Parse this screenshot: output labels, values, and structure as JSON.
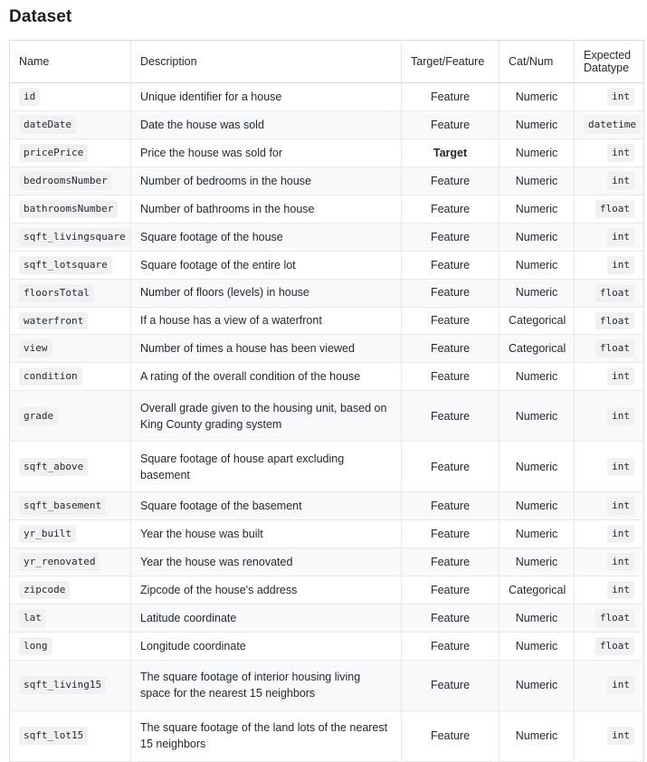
{
  "page": {
    "title": "Dataset"
  },
  "table": {
    "columns": [
      {
        "key": "name",
        "label": "Name"
      },
      {
        "key": "desc",
        "label": "Description"
      },
      {
        "key": "tf",
        "label": "Target/Feature"
      },
      {
        "key": "catnum",
        "label": "Cat/Num"
      },
      {
        "key": "dtype",
        "label": "Expected Datatype"
      }
    ],
    "rows": [
      {
        "name": "id",
        "desc": "Unique identifier for a house",
        "tf": "Feature",
        "catnum": "Numeric",
        "dtype": "int",
        "tall": false
      },
      {
        "name": "dateDate",
        "desc": "Date the house was sold",
        "tf": "Feature",
        "catnum": "Numeric",
        "dtype": "datetime",
        "tall": false
      },
      {
        "name": "pricePrice",
        "desc": "Price the house was sold for",
        "tf": "Target",
        "catnum": "Numeric",
        "dtype": "int",
        "tall": false
      },
      {
        "name": "bedroomsNumber",
        "desc": "Number of bedrooms in the house",
        "tf": "Feature",
        "catnum": "Numeric",
        "dtype": "int",
        "tall": false
      },
      {
        "name": "bathroomsNumber",
        "desc": "Number of bathrooms in the house",
        "tf": "Feature",
        "catnum": "Numeric",
        "dtype": "float",
        "tall": false
      },
      {
        "name": "sqft_livingsquare",
        "desc": "Square footage of the house",
        "tf": "Feature",
        "catnum": "Numeric",
        "dtype": "int",
        "tall": false
      },
      {
        "name": "sqft_lotsquare",
        "desc": "Square footage of the entire lot",
        "tf": "Feature",
        "catnum": "Numeric",
        "dtype": "int",
        "tall": false
      },
      {
        "name": "floorsTotal",
        "desc": "Number of floors (levels) in house",
        "tf": "Feature",
        "catnum": "Numeric",
        "dtype": "float",
        "tall": false
      },
      {
        "name": "waterfront",
        "desc": "If a house has a view of a waterfront",
        "tf": "Feature",
        "catnum": "Categorical",
        "dtype": "float",
        "tall": false
      },
      {
        "name": "view",
        "desc": "Number of times a house has been viewed",
        "tf": "Feature",
        "catnum": "Categorical",
        "dtype": "float",
        "tall": false
      },
      {
        "name": "condition",
        "desc": "A rating of the overall condition of the house",
        "tf": "Feature",
        "catnum": "Numeric",
        "dtype": "int",
        "tall": false
      },
      {
        "name": "grade",
        "desc": "Overall grade given to the housing unit, based on King County grading system",
        "tf": "Feature",
        "catnum": "Numeric",
        "dtype": "int",
        "tall": true
      },
      {
        "name": "sqft_above",
        "desc": "Square footage of house apart excluding basement",
        "tf": "Feature",
        "catnum": "Numeric",
        "dtype": "int",
        "tall": true
      },
      {
        "name": "sqft_basement",
        "desc": "Square footage of the basement",
        "tf": "Feature",
        "catnum": "Numeric",
        "dtype": "int",
        "tall": false
      },
      {
        "name": "yr_built",
        "desc": "Year the house was built",
        "tf": "Feature",
        "catnum": "Numeric",
        "dtype": "int",
        "tall": false
      },
      {
        "name": "yr_renovated",
        "desc": "Year the house was renovated",
        "tf": "Feature",
        "catnum": "Numeric",
        "dtype": "int",
        "tall": false
      },
      {
        "name": "zipcode",
        "desc": "Zipcode of the house's address",
        "tf": "Feature",
        "catnum": "Categorical",
        "dtype": "int",
        "tall": false
      },
      {
        "name": "lat",
        "desc": "Latitude coordinate",
        "tf": "Feature",
        "catnum": "Numeric",
        "dtype": "float",
        "tall": false
      },
      {
        "name": "long",
        "desc": "Longitude coordinate",
        "tf": "Feature",
        "catnum": "Numeric",
        "dtype": "float",
        "tall": false
      },
      {
        "name": "sqft_living15",
        "desc": "The square footage of interior housing living space for the nearest 15 neighbors",
        "tf": "Feature",
        "catnum": "Numeric",
        "dtype": "int",
        "tall": true
      },
      {
        "name": "sqft_lot15",
        "desc": "The square footage of the land lots of the nearest 15 neighbors",
        "tf": "Feature",
        "catnum": "Numeric",
        "dtype": "int",
        "tall": true
      }
    ]
  },
  "colors": {
    "text": "#24292e",
    "chip_bg": "#f0f1f2",
    "stripe_bg": "#f8f9fa",
    "border": "#e7eaec",
    "border_outer": "#d9dde1"
  }
}
